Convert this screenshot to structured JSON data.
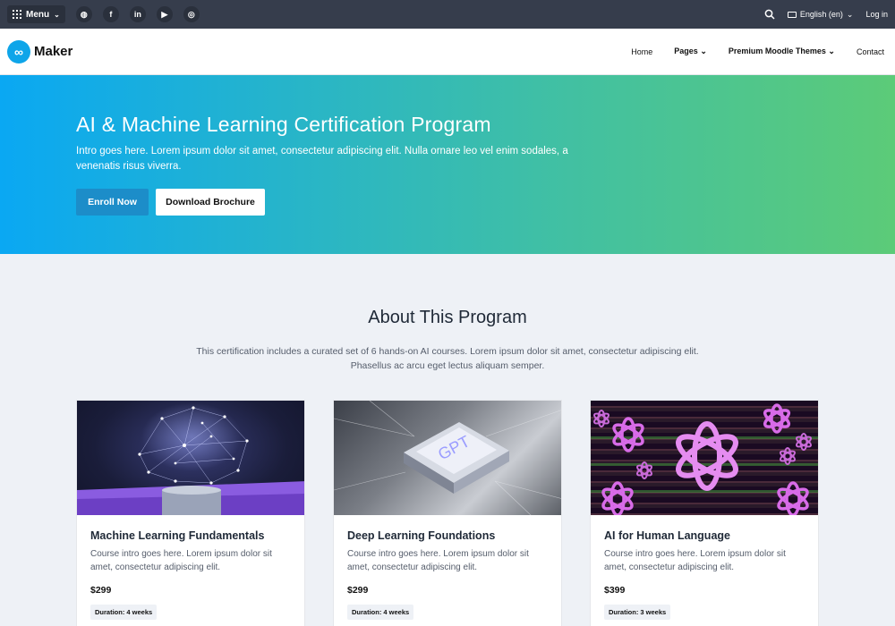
{
  "topbar": {
    "menu_label": "Menu",
    "social_icons": [
      "globe-icon",
      "facebook-icon",
      "linkedin-icon",
      "youtube-icon",
      "instagram-icon"
    ],
    "social_glyphs": [
      "◍",
      "f",
      "in",
      "▶",
      "◎"
    ],
    "language": "English (en)",
    "login": "Log in"
  },
  "navbar": {
    "logo_glyph": "∞",
    "brand": "Maker",
    "links": [
      {
        "label": "Home",
        "dropdown": false
      },
      {
        "label": "Pages",
        "dropdown": true
      },
      {
        "label": "Premium Moodle Themes",
        "dropdown": true
      },
      {
        "label": "Contact",
        "dropdown": false
      }
    ]
  },
  "hero": {
    "title": "AI & Machine Learning Certification Program",
    "intro": "Intro goes here. Lorem ipsum dolor sit amet, consectetur adipiscing elit. Nulla ornare leo vel enim sodales, a venenatis risus viverra.",
    "enroll_label": "Enroll Now",
    "brochure_label": "Download Brochure"
  },
  "about": {
    "title": "About This Program",
    "text": "This certification includes a curated set of 6 hands-on AI courses. Lorem ipsum dolor sit amet, consectetur adipiscing elit. Phasellus ac arcu eget lectus aliquam semper."
  },
  "courses": [
    {
      "title": "Machine Learning Fundamentals",
      "intro": "Course intro goes here. Lorem ipsum dolor sit amet, consectetur adipiscing elit.",
      "price": "$299",
      "duration": "Duration: 4 weeks"
    },
    {
      "title": "Deep Learning Foundations",
      "intro": "Course intro goes here. Lorem ipsum dolor sit amet, consectetur adipiscing elit.",
      "price": "$299",
      "duration": "Duration: 4 weeks"
    },
    {
      "title": "AI for Human Language",
      "intro": "Course intro goes here. Lorem ipsum dolor sit amet, consectetur adipiscing elit.",
      "price": "$399",
      "duration": "Duration: 3 weeks"
    }
  ],
  "images": {
    "card2_chip_text": "GPT"
  }
}
